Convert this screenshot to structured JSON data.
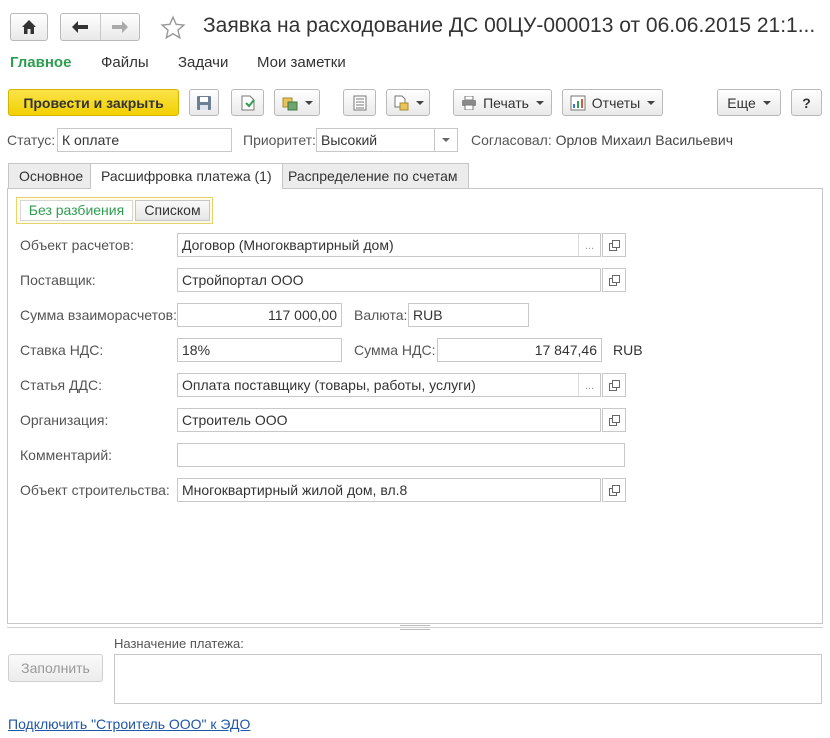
{
  "window": {
    "title": "Заявка на расходование ДС 00ЦУ-000013 от 06.06.2015 21:1..."
  },
  "nav": {
    "sections": [
      "Главное",
      "Файлы",
      "Задачи",
      "Мои заметки"
    ]
  },
  "toolbar": {
    "post_close": "Провести и закрыть",
    "print": "Печать",
    "reports": "Отчеты",
    "more": "Еще",
    "help": "?"
  },
  "status": {
    "status_label": "Статус:",
    "status_value": "К оплате",
    "priority_label": "Приоритет:",
    "priority_value": "Высокий",
    "approved_label": "Согласовал:",
    "approved_value": "Орлов Михаил Васильевич"
  },
  "tabs": [
    "Основное",
    "Расшифровка платежа (1)",
    "Распределение по счетам"
  ],
  "view_toggle": [
    "Без разбиения",
    "Списком"
  ],
  "form": {
    "object_label": "Объект расчетов:",
    "object_value": "Договор (Многоквартирный дом)",
    "supplier_label": "Поставщик:",
    "supplier_value": "Стройпортал ООО",
    "sum_label": "Сумма взаиморасчетов:",
    "sum_value": "117 000,00",
    "currency_label": "Валюта:",
    "currency_value": "RUB",
    "vat_rate_label": "Ставка НДС:",
    "vat_rate_value": "18%",
    "vat_sum_label": "Сумма НДС:",
    "vat_sum_value": "17 847,46",
    "vat_currency": "RUB",
    "cashflow_label": "Статья ДДС:",
    "cashflow_value": "Оплата поставщику (товары, работы, услуги)",
    "org_label": "Организация:",
    "org_value": "Строитель ООО",
    "comment_label": "Комментарий:",
    "comment_value": "",
    "site_label": "Объект строительства:",
    "site_value": "Многоквартирный жилой дом, вл.8"
  },
  "bottom": {
    "fill_button": "Заполнить",
    "purpose_label": "Назначение платежа:",
    "purpose_value": "",
    "edo_link": "Подключить \"Строитель ООО\" к ЭДО"
  },
  "colors": {
    "accent_green": "#2e9d4f",
    "primary_yellow": "#f5d500",
    "link_blue": "#2056a8"
  }
}
